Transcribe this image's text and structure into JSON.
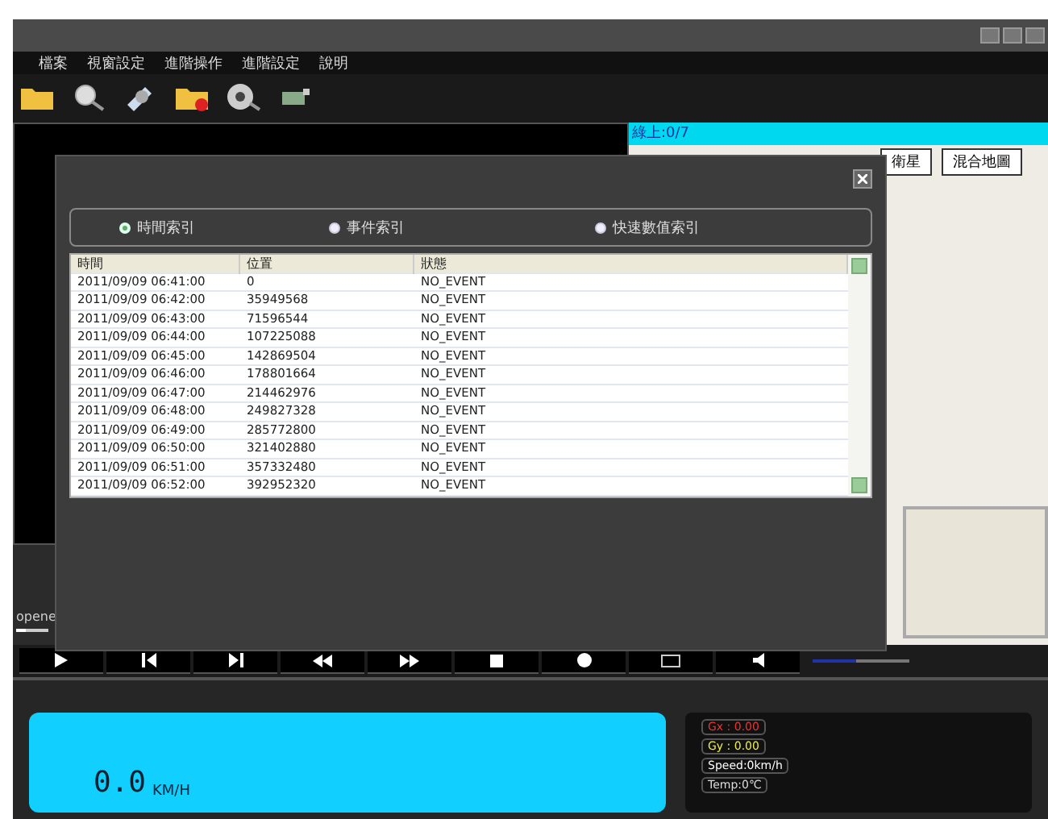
{
  "menu": [
    "檔案",
    "視窗設定",
    "進階操作",
    "進階設定",
    "說明"
  ],
  "toolbar": [
    {
      "kind": "folder"
    },
    {
      "kind": "search"
    },
    {
      "kind": "tools"
    },
    {
      "kind": "folder-delete"
    },
    {
      "kind": "film"
    },
    {
      "kind": "camera"
    }
  ],
  "video": {
    "label": "opene",
    "level": 0.3
  },
  "map": {
    "header": "綠上:0/7",
    "buttons": [
      "衛星",
      "混合地圖"
    ]
  },
  "dialog": {
    "index_options": [
      {
        "label": "時間索引",
        "selected": true
      },
      {
        "label": "事件索引",
        "selected": false
      },
      {
        "label": "快速數值索引",
        "selected": false
      }
    ],
    "table": {
      "columns": [
        "時間",
        "位置",
        "狀態"
      ],
      "rows": [
        [
          "2011/09/09 06:41:00",
          "0",
          "NO_EVENT"
        ],
        [
          "2011/09/09 06:42:00",
          "35949568",
          "NO_EVENT"
        ],
        [
          "2011/09/09 06:43:00",
          "71596544",
          "NO_EVENT"
        ],
        [
          "2011/09/09 06:44:00",
          "107225088",
          "NO_EVENT"
        ],
        [
          "2011/09/09 06:45:00",
          "142869504",
          "NO_EVENT"
        ],
        [
          "2011/09/09 06:46:00",
          "178801664",
          "NO_EVENT"
        ],
        [
          "2011/09/09 06:47:00",
          "214462976",
          "NO_EVENT"
        ],
        [
          "2011/09/09 06:48:00",
          "249827328",
          "NO_EVENT"
        ],
        [
          "2011/09/09 06:49:00",
          "285772800",
          "NO_EVENT"
        ],
        [
          "2011/09/09 06:50:00",
          "321402880",
          "NO_EVENT"
        ],
        [
          "2011/09/09 06:51:00",
          "357332480",
          "NO_EVENT"
        ],
        [
          "2011/09/09 06:52:00",
          "392952320",
          "NO_EVENT"
        ]
      ]
    }
  },
  "controls": [
    {
      "kind": "play"
    },
    {
      "kind": "prev"
    },
    {
      "kind": "next"
    },
    {
      "kind": "rewind"
    },
    {
      "kind": "forward"
    },
    {
      "kind": "stop"
    },
    {
      "kind": "record"
    },
    {
      "kind": "snapshot"
    },
    {
      "kind": "volume"
    }
  ],
  "volume": {
    "level": 0.45
  },
  "dashboard": {
    "speed": "0.0",
    "unit": "KM/H",
    "gx": "Gx : 0.00",
    "gy": "Gy : 0.00",
    "speed_label": "Speed:0km/h",
    "temp": "Temp:0℃"
  }
}
